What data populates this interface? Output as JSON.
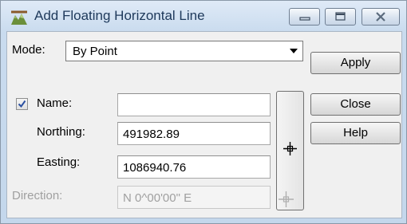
{
  "window": {
    "title": "Add Floating Horizontal Line",
    "icon": "floating-line-app-icon",
    "caption_buttons": [
      "minimize",
      "maximize",
      "close"
    ]
  },
  "mode": {
    "label": "Mode:",
    "selected": "By Point"
  },
  "buttons": {
    "apply": "Apply",
    "close": "Close",
    "help": "Help"
  },
  "name": {
    "checked": true,
    "label": "Name:",
    "value": ""
  },
  "northing": {
    "label": "Northing:",
    "value": "491982.89"
  },
  "easting": {
    "label": "Easting:",
    "value": "1086940.76"
  },
  "direction": {
    "label": "Direction:",
    "value": "N  0^00'00\" E",
    "enabled": false
  },
  "colors": {
    "title_text": "#1e395b",
    "title_bar": "#c9dbee",
    "client_bg": "#f0f0f0",
    "disabled_text": "#a0a0a0"
  }
}
